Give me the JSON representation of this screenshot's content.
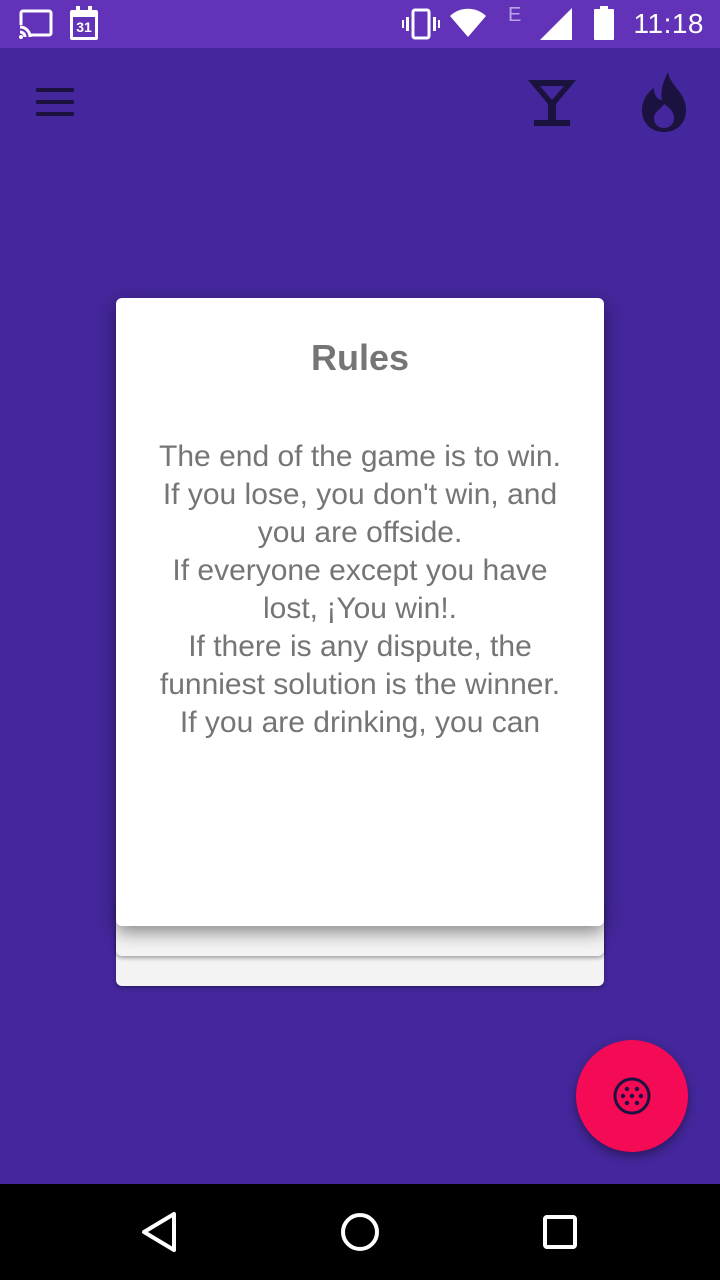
{
  "status_bar": {
    "time": "11:18",
    "calendar_day": "31",
    "network_type": "E",
    "icons": [
      "cast-icon",
      "calendar-icon",
      "vibrate-icon",
      "wifi-icon",
      "cell-signal-icon",
      "battery-icon"
    ]
  },
  "app_bar": {
    "icons": [
      "menu-icon",
      "cocktail-icon",
      "flame-icon"
    ]
  },
  "card": {
    "title": "Rules",
    "body": "The end of the game is to win.\nIf you lose, you don't win, and you are offside.\nIf everyone except you have lost, ¡You win!.\nIf there is any dispute, the funniest solution is the winner.\nIf you are drinking, you can"
  },
  "fab": {
    "icon": "dice-icon"
  },
  "nav_bar": {
    "icons": [
      "back-icon",
      "home-icon",
      "recents-icon"
    ]
  },
  "colors": {
    "background": "#44279c",
    "status_bar": "#6232b8",
    "fab": "#f50a55",
    "card_text": "#757575",
    "app_bar_icons": "#1b1240"
  }
}
